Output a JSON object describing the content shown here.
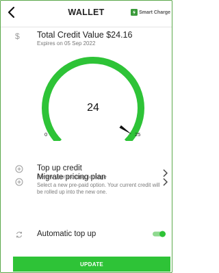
{
  "header": {
    "title": "WALLET",
    "brand_label": "Smart Charge"
  },
  "credit": {
    "currency_symbol": "$",
    "title": "Total Credit Value $24.16",
    "expiry": "Expires on 05 Sep 2022"
  },
  "gauge": {
    "value_label": "24",
    "min_label": "0",
    "max_label": "25",
    "value": 24,
    "min": 0,
    "max": 25,
    "color": "#2ec337"
  },
  "menu": {
    "top_up": {
      "title": "Top up credit",
      "subtitle": "Renew your existing package"
    },
    "migrate": {
      "title": "Migrate pricing plan",
      "subtitle": "Select a new pre-paid option. Your current credit will be rolled up into the new one."
    },
    "auto_top_up": {
      "title": "Automatic top up",
      "enabled": true
    }
  },
  "actions": {
    "update_label": "UPDATE"
  },
  "colors": {
    "accent": "#2ec337",
    "border": "#5aa84a"
  }
}
